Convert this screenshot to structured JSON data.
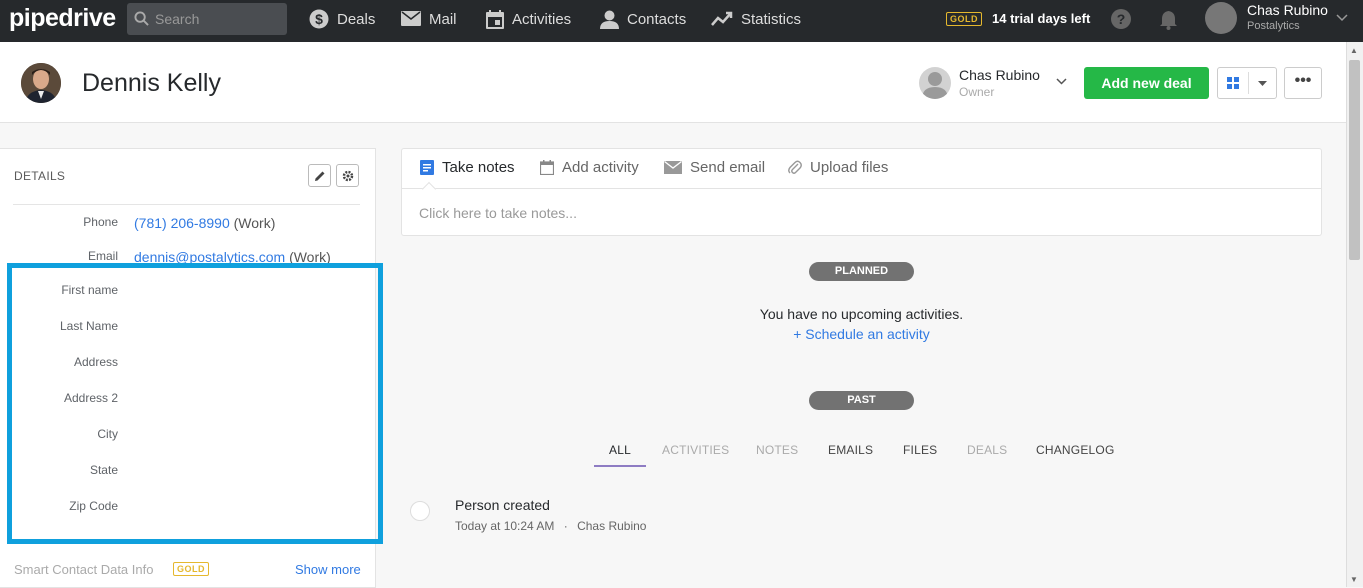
{
  "topbar": {
    "logo": "pipedrive",
    "search_placeholder": "Search",
    "nav": [
      {
        "label": "Deals",
        "icon": "dollar-icon"
      },
      {
        "label": "Mail",
        "icon": "mail-icon"
      },
      {
        "label": "Activities",
        "icon": "calendar-icon"
      },
      {
        "label": "Contacts",
        "icon": "person-icon"
      },
      {
        "label": "Statistics",
        "icon": "chart-icon"
      }
    ],
    "badge": "GOLD",
    "trial": "14 trial days left",
    "user_name": "Chas Rubino",
    "user_company": "Postalytics"
  },
  "header": {
    "person_name": "Dennis Kelly",
    "owner_name": "Chas Rubino",
    "owner_role": "Owner",
    "add_deal": "Add new deal",
    "more": "•••"
  },
  "details": {
    "title": "DETAILS",
    "phone_label": "Phone",
    "phone_value": "(781) 206-8990",
    "phone_suffix": "(Work)",
    "email_label": "Email",
    "email_value": "dennis@postalytics.com",
    "email_suffix": "(Work)",
    "fields": [
      "First name",
      "Last Name",
      "Address",
      "Address 2",
      "City",
      "State",
      "Zip Code"
    ],
    "smart": "Smart Contact Data Info",
    "smart_badge": "GOLD",
    "show_more": "Show more"
  },
  "composer": {
    "tabs": [
      "Take notes",
      "Add activity",
      "Send email",
      "Upload files"
    ],
    "placeholder": "Click here to take notes..."
  },
  "timeline": {
    "planned": "PLANNED",
    "no_activities": "You have no upcoming activities.",
    "schedule": "+ Schedule an activity",
    "past": "PAST",
    "filters": [
      "ALL",
      "ACTIVITIES",
      "NOTES",
      "EMAILS",
      "FILES",
      "DEALS",
      "CHANGELOG"
    ],
    "event_title": "Person created",
    "event_time": "Today at 10:24 AM",
    "event_sep": "·",
    "event_user": "Chas Rubino"
  },
  "colors": {
    "topbar": "#26292c",
    "accent_green": "#25b847",
    "link_blue": "#317ae2",
    "highlight": "#0fa0dd",
    "gold": "#e5b82e"
  }
}
